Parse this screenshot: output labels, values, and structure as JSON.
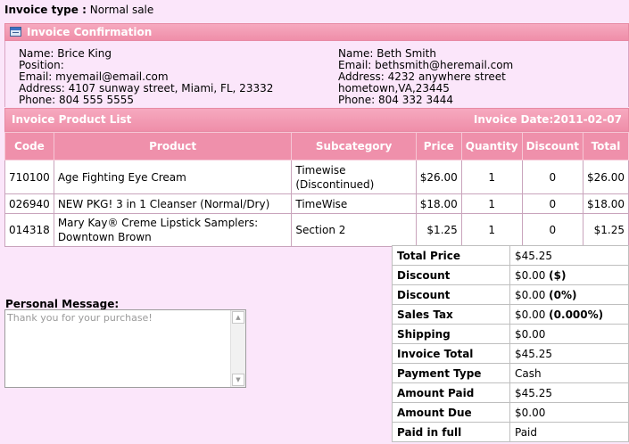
{
  "invoice_type": {
    "label": "Invoice type :",
    "value": "Normal sale"
  },
  "confirmation": {
    "title": "Invoice Confirmation",
    "icon": "window-icon",
    "left": [
      "Name: Brice King",
      "Position:",
      "Email: myemail@email.com",
      "Address: 4107 sunway street, Miami, FL, 23332",
      "Phone: 804 555 5555"
    ],
    "right": [
      "Name: Beth Smith",
      "Email: bethsmith@heremail.com",
      "Address: 4232 anywhere street",
      "hometown,VA,23445",
      "Phone: 804 332 3444"
    ]
  },
  "product_list": {
    "title": "Invoice Product List",
    "invoice_date": "Invoice Date:2011-02-07",
    "headers": [
      "Code",
      "Product",
      "Subcategory",
      "Price",
      "Quantity",
      "Discount",
      "Total"
    ],
    "rows": [
      {
        "code": "710100",
        "product": "Age Fighting Eye Cream",
        "subcategory": "Timewise (Discontinued)",
        "price": "$26.00",
        "quantity": "1",
        "discount": "0",
        "total": "$26.00"
      },
      {
        "code": "026940",
        "product": "NEW PKG! 3 in 1 Cleanser (Normal/Dry)",
        "subcategory": "TimeWise",
        "price": "$18.00",
        "quantity": "1",
        "discount": "0",
        "total": "$18.00"
      },
      {
        "code": "014318",
        "product": "Mary Kay® Creme Lipstick Samplers: Downtown Brown",
        "subcategory": "Section 2",
        "price": "$1.25",
        "quantity": "1",
        "discount": "0",
        "total": "$1.25"
      }
    ]
  },
  "personal_message": {
    "label": "Personal Message:",
    "placeholder": "Thank you for your purchase!"
  },
  "totals": [
    {
      "label": "Total Price",
      "value": "$45.25",
      "extra": ""
    },
    {
      "label": "Discount",
      "value": "$0.00 ",
      "extra": "($)"
    },
    {
      "label": "Discount",
      "value": "$0.00 ",
      "extra": "(0%)"
    },
    {
      "label": "Sales Tax",
      "value": "$0.00 ",
      "extra": "(0.000%)"
    },
    {
      "label": "Shipping",
      "value": "$0.00",
      "extra": ""
    },
    {
      "label": "Invoice Total",
      "value": "$45.25",
      "extra": ""
    },
    {
      "label": "Payment Type",
      "value": "Cash",
      "extra": ""
    },
    {
      "label": "Amount Paid",
      "value": "$45.25",
      "extra": ""
    },
    {
      "label": "Amount Due",
      "value": "$0.00",
      "extra": ""
    },
    {
      "label": "Paid in full",
      "value": "Paid",
      "extra": ""
    }
  ]
}
